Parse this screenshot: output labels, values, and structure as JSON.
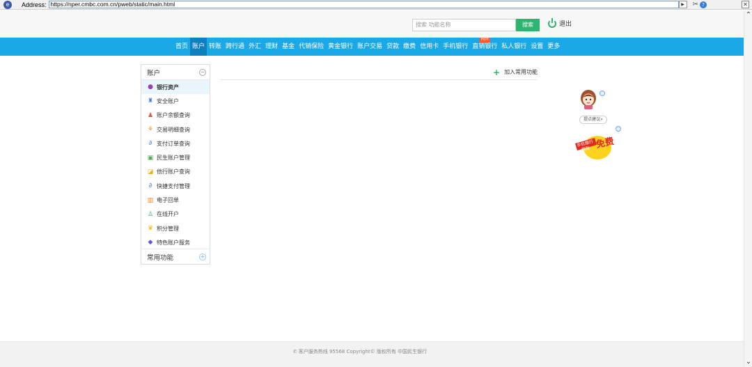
{
  "address_bar": {
    "label": "Address:",
    "url": "https://nper.cmbc.com.cn/pweb/static/main.html"
  },
  "header": {
    "search_placeholder": "搜索 功能名称",
    "search_button": "搜索",
    "logout_label": "退出"
  },
  "nav": {
    "items": [
      {
        "label": "首页"
      },
      {
        "label": "账户"
      },
      {
        "label": "转账"
      },
      {
        "label": "跨行通"
      },
      {
        "label": "外汇"
      },
      {
        "label": "理财"
      },
      {
        "label": "基金"
      },
      {
        "label": "代销保险"
      },
      {
        "label": "黄金银行"
      },
      {
        "label": "账户交易"
      },
      {
        "label": "贷款"
      },
      {
        "label": "缴费"
      },
      {
        "label": "信用卡"
      },
      {
        "label": "手机银行"
      },
      {
        "label": "直销银行"
      },
      {
        "label": "私人银行"
      },
      {
        "label": "设置"
      },
      {
        "label": "更多"
      }
    ],
    "active_index": 1,
    "hot_badge": "HOT"
  },
  "sidebar": {
    "title": "账户",
    "items": [
      {
        "label": "银行资产",
        "icon": "asset-icon",
        "color": "#9b3fb5"
      },
      {
        "label": "安全账户",
        "icon": "safe-account-icon",
        "color": "#3a7bd5"
      },
      {
        "label": "账户余额查询",
        "icon": "balance-query-icon",
        "color": "#e0533a"
      },
      {
        "label": "交易明细查询",
        "icon": "transaction-detail-icon",
        "color": "#f08a24"
      },
      {
        "label": "支付订单查询",
        "icon": "payment-order-icon",
        "color": "#3a7bd5"
      },
      {
        "label": "民生账户管理",
        "icon": "account-manage-icon",
        "color": "#4caf50"
      },
      {
        "label": "他行账户查询",
        "icon": "other-bank-icon",
        "color": "#f0b400"
      },
      {
        "label": "快捷支付管理",
        "icon": "quick-pay-icon",
        "color": "#3a7bd5"
      },
      {
        "label": "电子回单",
        "icon": "e-receipt-icon",
        "color": "#f08a24"
      },
      {
        "label": "在线开户",
        "icon": "online-account-icon",
        "color": "#2db46e"
      },
      {
        "label": "积分管理",
        "icon": "points-icon",
        "color": "#f0b400"
      },
      {
        "label": "特色账户服务",
        "icon": "special-service-icon",
        "color": "#5a5ad6"
      }
    ],
    "footer_title": "常用功能"
  },
  "main": {
    "add_favorite": "加入常用功能"
  },
  "widgets": {
    "suggest_label": "提点建议»",
    "promo_line1": "手机银行",
    "promo_line2": "转账",
    "promo_big": "免费"
  },
  "footer": {
    "text": "客户服务热线 95568 Copyright© 版权所有 中国民生银行"
  }
}
